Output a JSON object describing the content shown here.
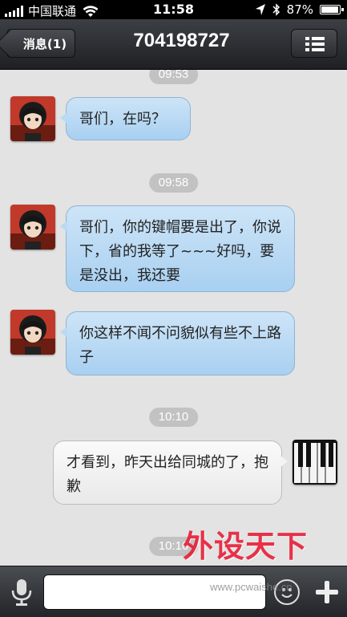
{
  "status_bar": {
    "carrier": "中国联通",
    "time": "11:58",
    "battery_text": "87%",
    "battery_level": 0.87
  },
  "nav": {
    "back_label": "消息(1)",
    "title": "704198727",
    "menu_icon": "list-menu-icon"
  },
  "messages": [
    {
      "type": "time",
      "text": "09:53"
    },
    {
      "type": "in",
      "text": "哥们，在吗？"
    },
    {
      "type": "time",
      "text": "09:58"
    },
    {
      "type": "in",
      "text": "哥们，你的键帽要是出了，你说下，省的我等了~~~好吗，要是没出，我还要"
    },
    {
      "type": "in",
      "text": "你这样不闻不问貌似有些不上路子"
    },
    {
      "type": "time",
      "text": "10:10"
    },
    {
      "type": "out",
      "text": "才看到，昨天出给同城的了，抱歉"
    },
    {
      "type": "time",
      "text": "10:16"
    }
  ],
  "input_bar": {
    "mic_icon": "microphone-icon",
    "input_value": "",
    "emoji_icon": "emoji-icon",
    "plus_icon": "plus-icon"
  },
  "watermark": {
    "text": "外设天下",
    "url": "www.pcwaishe.cn"
  },
  "colors": {
    "incoming_bubble": "#b9daf4",
    "outgoing_bubble": "#f3f3f3",
    "time_pill": "#c2c2c2",
    "watermark": "#e8122e"
  }
}
